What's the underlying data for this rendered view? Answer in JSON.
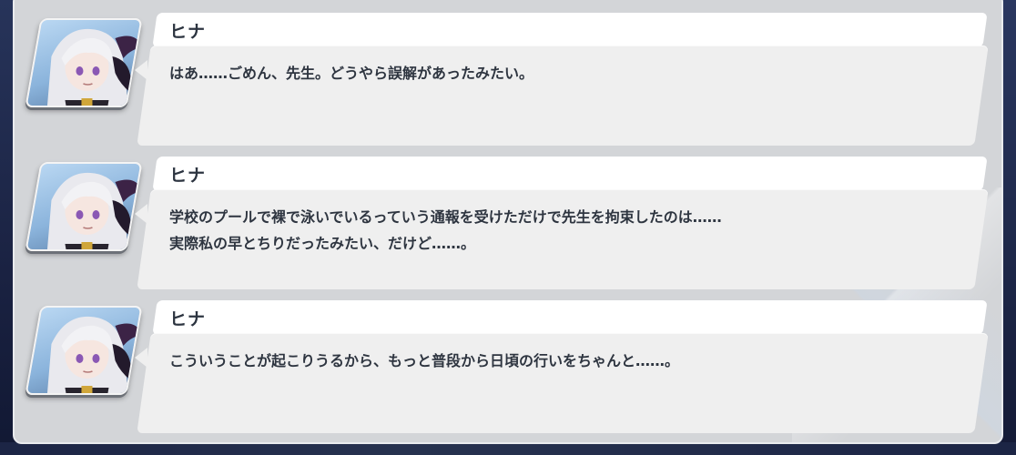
{
  "log": {
    "entries": [
      {
        "speaker": "ヒナ",
        "text": "はあ……ごめん、先生。どうやら誤解があったみたい。"
      },
      {
        "speaker": "ヒナ",
        "text": "学校のプールで裸で泳いでいるっていう通報を受けただけで先生を拘束したのは……\n実際私の早とちりだったみたい、だけど……。"
      },
      {
        "speaker": "ヒナ",
        "text": "こういうことが起こりうるから、もっと普段から日頃の行いをちゃんと……。"
      }
    ]
  },
  "icons": {
    "portrait": "hina-portrait-icon"
  },
  "colors": {
    "panel": "#d3d5d8",
    "name_plate": "#ffffff",
    "message_box": "#efefef",
    "text": "#2e3540"
  }
}
